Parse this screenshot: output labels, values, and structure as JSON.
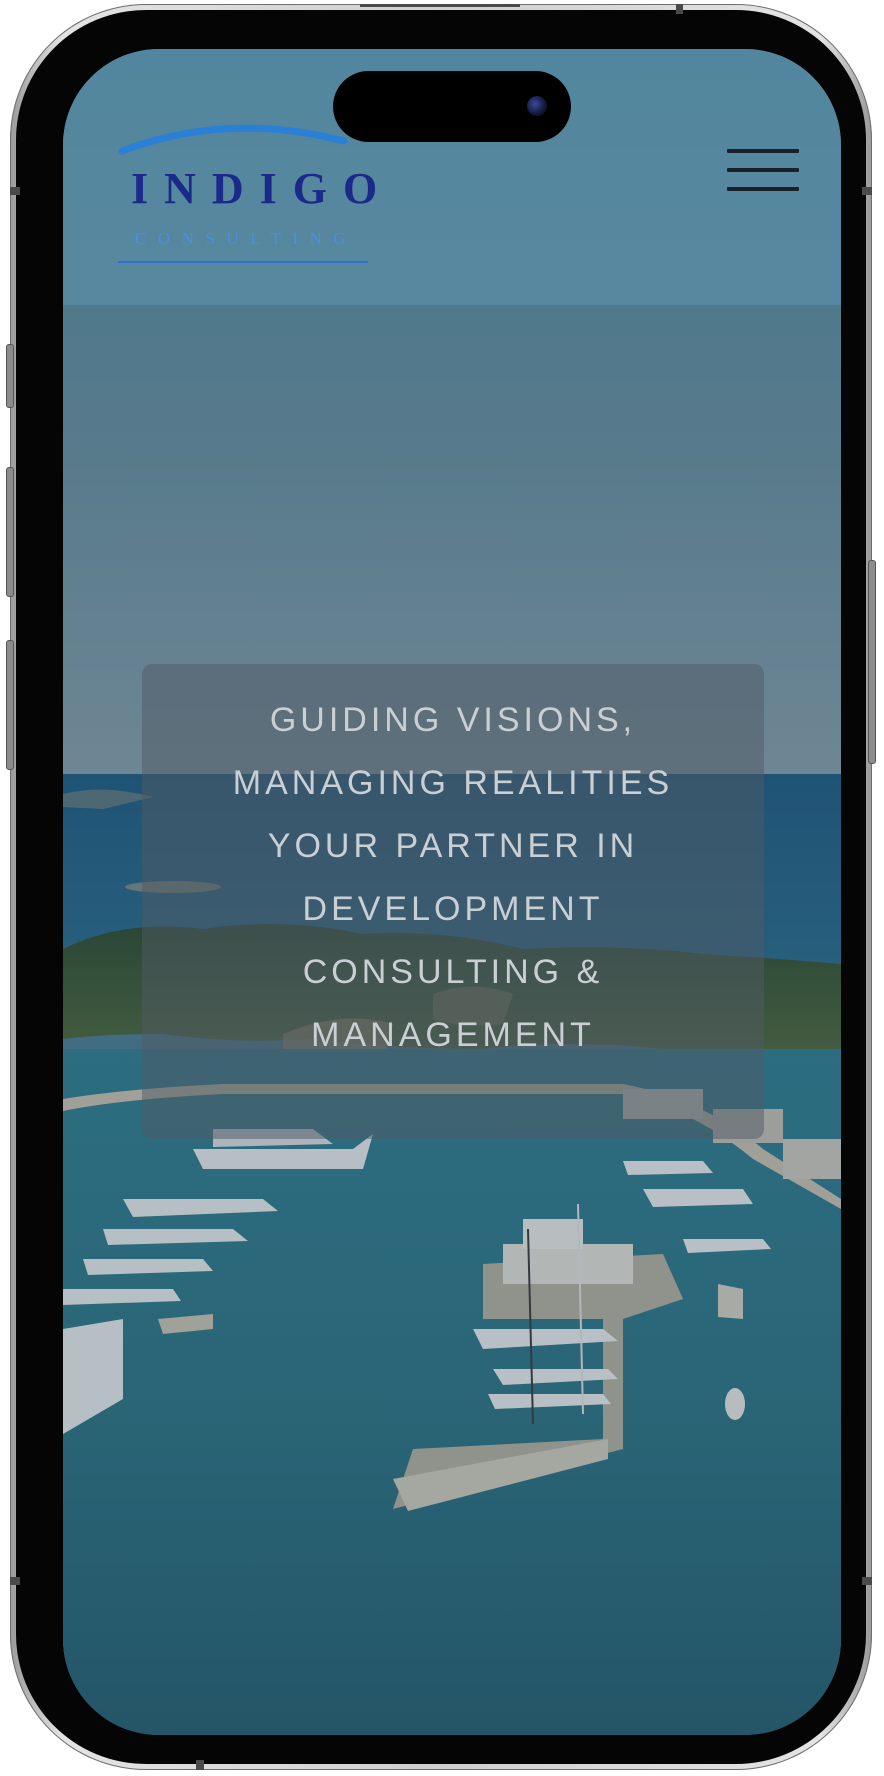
{
  "logo": {
    "word": "INDIGO",
    "sub": "CONSULTING"
  },
  "hero": {
    "lines": [
      "GUIDING VISIONS,",
      "MANAGING REALITIES",
      "YOUR PARTNER IN",
      "DEVELOPMENT",
      "CONSULTING &",
      "MANAGEMENT"
    ]
  },
  "icons": {
    "menu": "hamburger-menu-icon"
  },
  "colors": {
    "logo_primary": "#1b2a8a",
    "logo_secondary": "#4a8fe0",
    "header_tint": "#5f96af",
    "sea": "#2f7d90",
    "hero_text": "#c9cfd3"
  }
}
